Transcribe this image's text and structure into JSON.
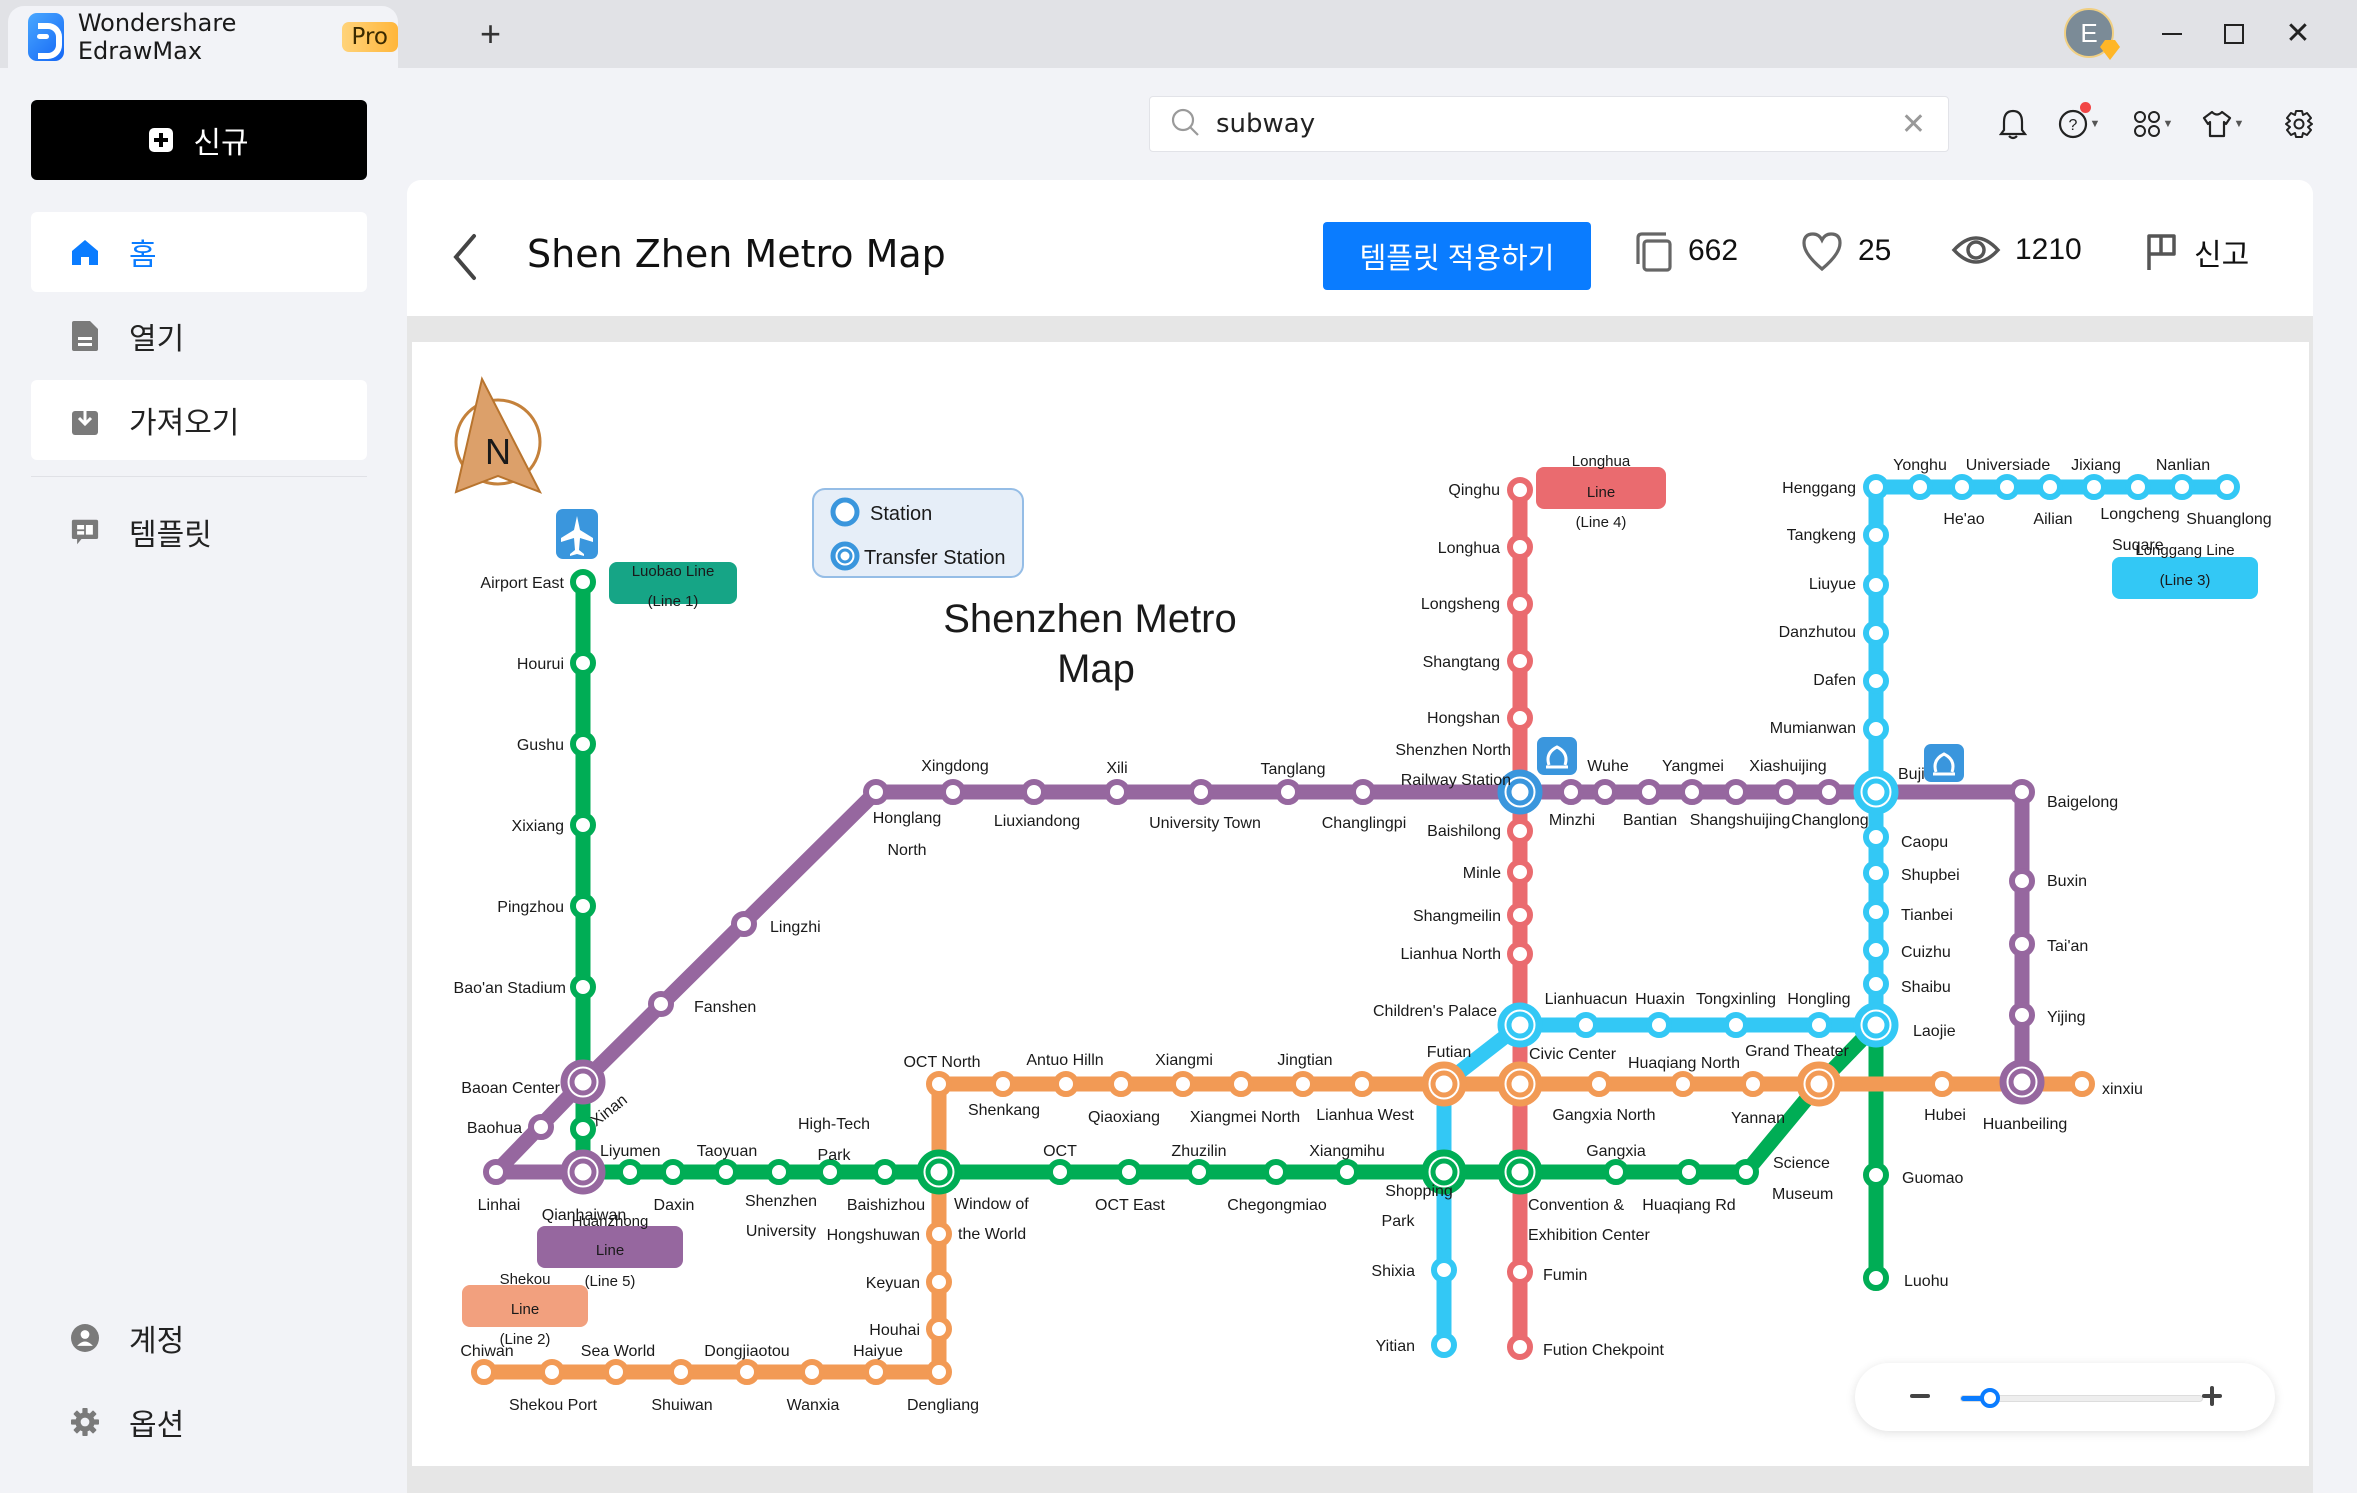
{
  "app": {
    "name": "Wondershare EdrawMax",
    "badge": "Pro",
    "new_tab_icon": "plus-icon",
    "user_initial": "E"
  },
  "sidebar": {
    "new_button": "신규",
    "items": [
      {
        "label": "홈",
        "icon": "home-icon",
        "active": true
      },
      {
        "label": "열기",
        "icon": "file-icon"
      },
      {
        "label": "가져오기",
        "icon": "import-icon"
      },
      {
        "label": "템플릿",
        "icon": "template-icon"
      }
    ],
    "bottom_items": [
      {
        "label": "계정",
        "icon": "account-icon"
      },
      {
        "label": "옵션",
        "icon": "gear-icon"
      }
    ]
  },
  "search": {
    "value": "subway",
    "placeholder": ""
  },
  "toolbar_icons": [
    "bell-icon",
    "help-icon",
    "apps-icon",
    "theme-shirt-icon",
    "settings-icon"
  ],
  "template": {
    "title": "Shen Zhen Metro Map",
    "apply_button": "템플릿 적용하기",
    "duplicates": "662",
    "likes": "25",
    "views": "1210",
    "report": "신고"
  },
  "zoom": {
    "level_fraction": 0.12
  },
  "map": {
    "title_line1": "Shenzhen Metro",
    "title_line2": "Map",
    "compass": "N",
    "legend": {
      "station": "Station",
      "transfer": "Transfer Station"
    },
    "colors": {
      "line1": "#f29a55",
      "line2": "#f29a55",
      "line3": "#33c8f5",
      "line4": "#ea6b6f",
      "line5": "#96679f",
      "luobao": "#00ad55",
      "transfer_blue": "#3a96dd"
    },
    "line_labels": {
      "luobao": [
        "Luobao Line",
        "(Line 1)"
      ],
      "longhua": [
        "Longhua",
        "Line",
        "(Line 4)"
      ],
      "longgang": [
        "Longgang Line",
        "(Line 3)"
      ],
      "huanzhong": [
        "Huanzhong",
        "Line",
        "(Line 5)"
      ],
      "shekou": [
        "Shekou",
        "Line",
        "(Line 2)"
      ]
    },
    "stations": {
      "airport_east": "Airport East",
      "hourui": "Hourui",
      "gushu": "Gushu",
      "xixiang": "Xixiang",
      "pingzhou": "Pingzhou",
      "baoan_stadium": "Bao'an Stadium",
      "baoan_center": "Baoan Center",
      "xinan": "Xinan",
      "baohua": "Baohua",
      "linhai": "Linhai",
      "qianhaiwan": "Qianhaiwan",
      "liyumen": "Liyumen",
      "daxin": "Daxin",
      "taoyuan": "Taoyuan",
      "shenzhen_univ_1": "Shenzhen",
      "shenzhen_univ_2": "University",
      "hightech_1": "High-Tech",
      "hightech_2": "Park",
      "baishizhou": "Baishizhou",
      "window_1": "Window of",
      "window_2": "the World",
      "oct": "OCT",
      "oct_east": "OCT East",
      "zhuzilin": "Zhuzilin",
      "chegongmiao": "Chegongmiao",
      "xiangmihu": "Xiangmihu",
      "shopping_1": "Shopping",
      "shopping_2": "Park",
      "convention_1": "Convention &",
      "convention_2": "Exhibition Center",
      "gangxia": "Gangxia",
      "huaqiang_rd": "Huaqiang Rd",
      "science_1": "Science",
      "science_2": "Museum",
      "guomao": "Guomao",
      "luohu": "Luohu",
      "fanshen": "Fanshen",
      "lingzhi": "Lingzhi",
      "honglang_1": "Honglang",
      "honglang_2": "North",
      "xingdong": "Xingdong",
      "liuxiandong": "Liuxiandong",
      "xili": "Xili",
      "university_town": "University Town",
      "tanglang": "Tanglang",
      "changlingpi": "Changlingpi",
      "sz_north_1": "Shenzhen North",
      "sz_north_2": "Railway Station",
      "minzhi": "Minzhi",
      "wuhe": "Wuhe",
      "bantian": "Bantian",
      "yangmei": "Yangmei",
      "shangshuijing": "Shangshuijing",
      "xiashuijing": "Xiashuijing",
      "changlong": "Changlong",
      "buji": "Buji",
      "baigelong": "Baigelong",
      "buxin": "Buxin",
      "taian": "Tai'an",
      "yijing": "Yijing",
      "huanbeiling": "Huanbeiling",
      "qinghu": "Qinghu",
      "longhua": "Longhua",
      "longsheng": "Longsheng",
      "shangtang": "Shangtang",
      "hongshan": "Hongshan",
      "baishilong": "Baishilong",
      "minle": "Minle",
      "shangmeilin": "Shangmeilin",
      "lianhua_north": "Lianhua North",
      "childrens_palace": "Children's Palace",
      "civic_center": "Civic Center",
      "fumin": "Fumin",
      "futian_checkpoint": "Fution Chekpoint",
      "henggang": "Henggang",
      "tangkeng": "Tangkeng",
      "liuyue": "Liuyue",
      "danzhutou": "Danzhutou",
      "dafen": "Dafen",
      "mumianwan": "Mumianwan",
      "caopu": "Caopu",
      "shupbei": "Shupbei",
      "tianbei": "Tianbei",
      "cuizhu": "Cuizhu",
      "shaibu": "Shaibu",
      "laojie": "Laojie",
      "yonghu": "Yonghu",
      "heao": "He'ao",
      "universiade": "Universiade",
      "ailian": "Ailian",
      "jixiang": "Jixiang",
      "longcheng": "Longcheng",
      "square": "Suqare",
      "nanlian": "Nanlian",
      "shuanglong": "Shuanglong",
      "lianhuacun": "Lianhuacun",
      "huaxin": "Huaxin",
      "tongxinling": "Tongxinling",
      "hongling": "Hongling",
      "futian": "Futian",
      "shixia": "Shixia",
      "yitian": "Yitian",
      "oct_north": "OCT North",
      "shenkang": "Shenkang",
      "antuo_hill": "Antuo Hilln",
      "qiaoxiang": "Qiaoxiang",
      "xiangmi": "Xiangmi",
      "xiangmei_north": "Xiangmei North",
      "jingtian": "Jingtian",
      "lianhua_west": "Lianhua West",
      "gangxia_north": "Gangxia North",
      "huaqiang_north": "Huaqiang North",
      "yannan": "Yannan",
      "grand_theater": "Grand Theater",
      "hubei": "Hubei",
      "xinxiu": "xinxiu",
      "hongshuwan": "Hongshuwan",
      "keyuan": "Keyuan",
      "houhai": "Houhai",
      "dengliang": "Dengliang",
      "haiyue": "Haiyue",
      "wanxia": "Wanxia",
      "dongjiaotou": "Dongjiaotou",
      "shuiwan": "Shuiwan",
      "sea_world": "Sea World",
      "shekou_port": "Shekou Port",
      "chiwan": "Chiwan"
    }
  }
}
